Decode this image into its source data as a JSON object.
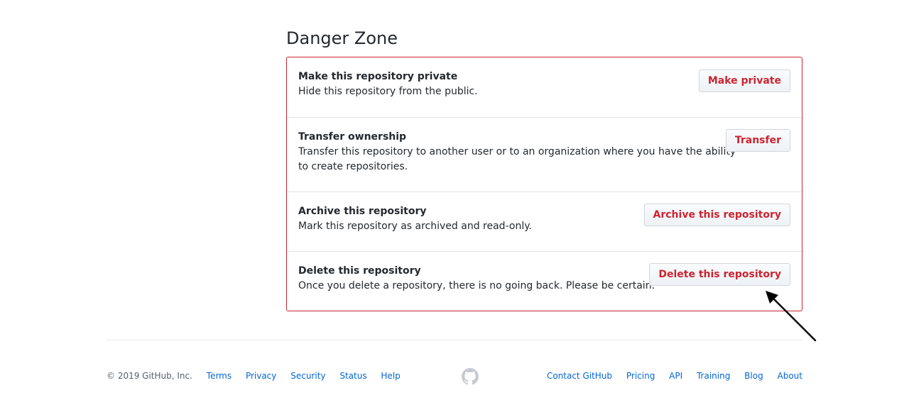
{
  "danger_zone": {
    "title": "Danger Zone",
    "items": [
      {
        "title": "Make this repository private",
        "description_lines": [
          "Hide this repository from the public."
        ],
        "button_label": "Make private"
      },
      {
        "title": "Transfer ownership",
        "description_lines": [
          "Transfer this repository to another user or to an organization where you have the ability",
          "to create repositories."
        ],
        "button_label": "Transfer"
      },
      {
        "title": "Archive this repository",
        "description_lines": [
          "Mark this repository as archived and read-only."
        ],
        "button_label": "Archive this repository"
      },
      {
        "title": "Delete this repository",
        "description_lines": [
          "Once you delete a repository, there is no going back. Please be certain."
        ],
        "button_label": "Delete this repository"
      }
    ]
  },
  "footer": {
    "copyright": "© 2019 GitHub, Inc.",
    "left_links": [
      "Terms",
      "Privacy",
      "Security",
      "Status",
      "Help"
    ],
    "right_links": [
      "Contact GitHub",
      "Pricing",
      "API",
      "Training",
      "Blog",
      "About"
    ],
    "logo_icon": "github-mark-icon"
  },
  "annotation": {
    "arrow_icon": "pointer-arrow-icon"
  },
  "colors": {
    "danger": "#cb2431",
    "link": "#0366d6",
    "muted": "#586069",
    "text": "#24292e"
  }
}
